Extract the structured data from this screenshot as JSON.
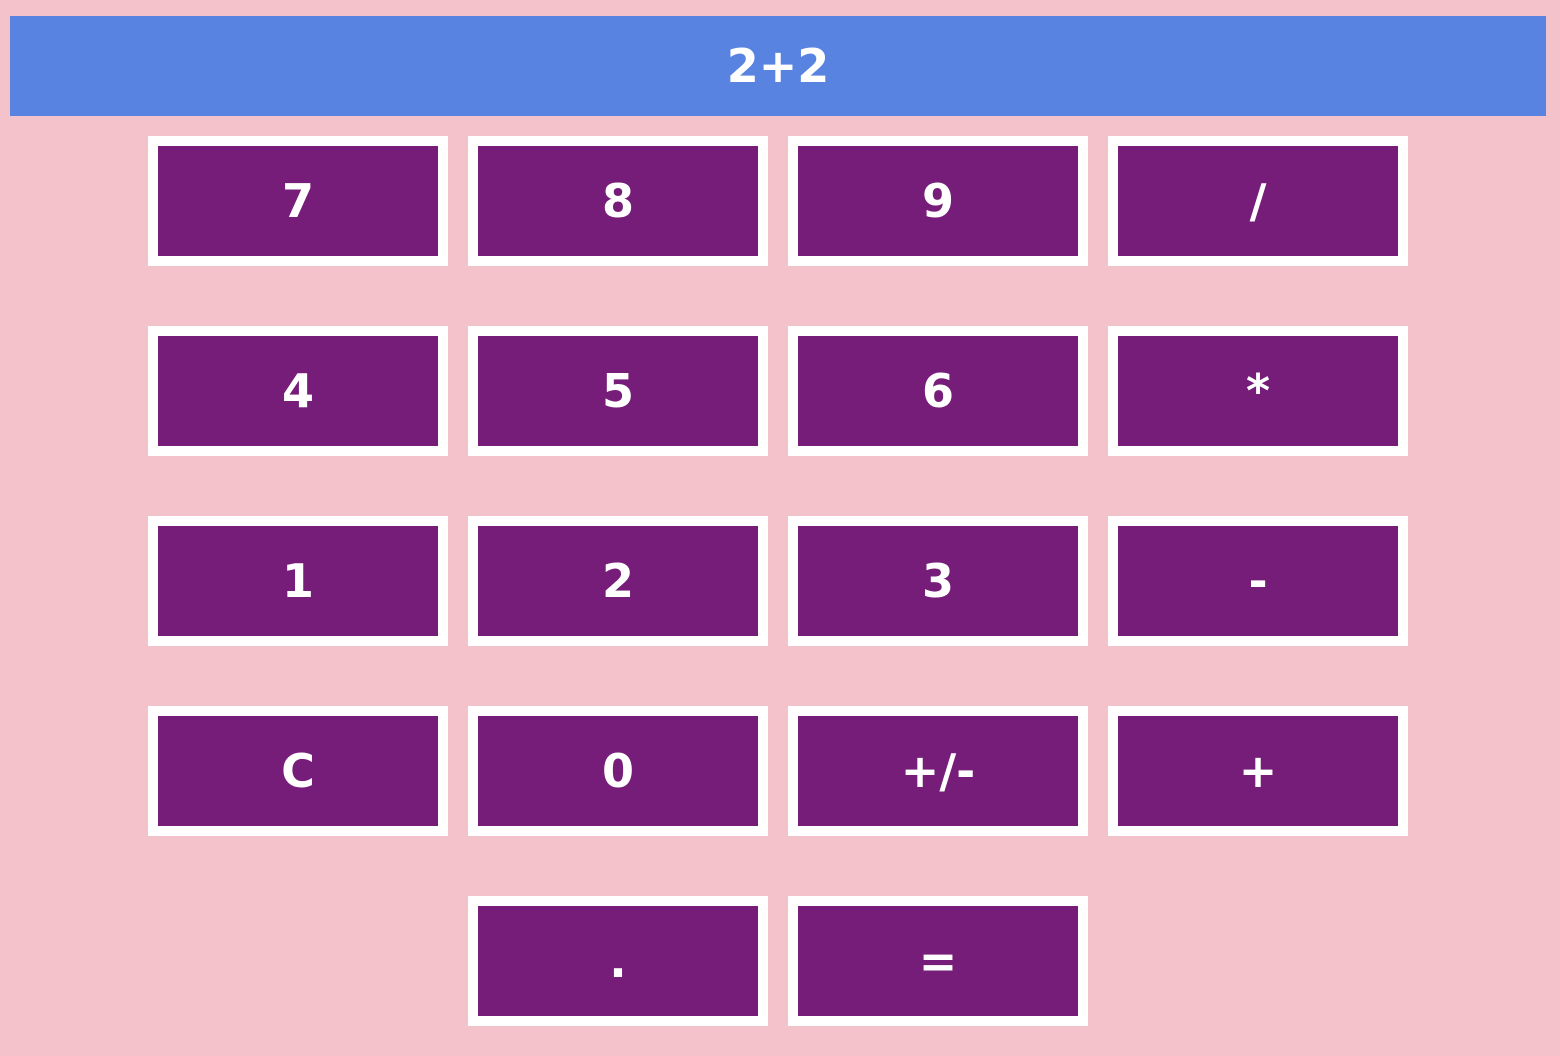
{
  "display": {
    "value": "2+2"
  },
  "keys": {
    "k7": "7",
    "k8": "8",
    "k9": "9",
    "divide": "/",
    "k4": "4",
    "k5": "5",
    "k6": "6",
    "multiply": "*",
    "k1": "1",
    "k2": "2",
    "k3": "3",
    "subtract": "-",
    "clear": "C",
    "k0": "0",
    "negate": "+/-",
    "add": "+",
    "decimal": ".",
    "equals": "="
  },
  "colors": {
    "background": "#f4c2cb",
    "display": "#5883e0",
    "key": "#761c79",
    "key_border": "#ffffff",
    "text": "#ffffff"
  }
}
